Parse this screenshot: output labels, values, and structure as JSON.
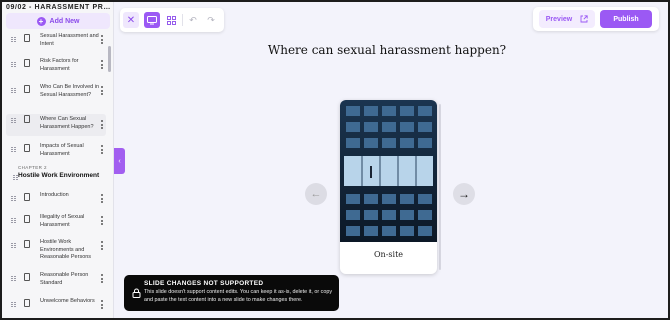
{
  "sidebar": {
    "course_title": "09/02 - HARASSMENT PRE...",
    "add_new_label": "Add New",
    "lessons_top": [
      {
        "label": "Sexual Harassment and Intent"
      },
      {
        "label": "Risk Factors for Harassment"
      },
      {
        "label": "Who Can Be Involved in Sexual Harassment?"
      },
      {
        "label": "Where Can Sexual Harassment Happen?",
        "active": true
      },
      {
        "label": "Impacts of Sexual Harassment"
      }
    ],
    "chapter": {
      "number_label": "CHAPTER 2",
      "title": "Hostile Work Environment"
    },
    "lessons_chapter": [
      {
        "label": "Introduction"
      },
      {
        "label": "Illegality of Sexual Harassment"
      },
      {
        "label": "Hostile Work Environments and Reasonable Persons"
      },
      {
        "label": "Reasonable Person Standard"
      },
      {
        "label": "Unwelcome Behaviors"
      }
    ],
    "collapse_icon": "chevron-left-icon"
  },
  "toolbar": {
    "close_icon": "close-icon",
    "desktop_icon": "desktop-icon",
    "grid_icon": "grid-icon",
    "undo_icon": "undo-icon",
    "redo_icon": "redo-icon"
  },
  "actions": {
    "preview_label": "Preview",
    "publish_label": "Publish"
  },
  "slide": {
    "title": "Where can sexual harassment happen?",
    "card_label": "On-site",
    "prev_icon": "arrow-left-icon",
    "next_icon": "arrow-right-icon"
  },
  "toast": {
    "title": "SLIDE CHANGES NOT SUPPORTED",
    "body": "This slide doesn't support content edits. You can keep it as-is, delete it, or copy and paste the text content into a new slide to make changes there."
  },
  "colors": {
    "accent": "#9b59f4",
    "accent_light": "#efe7fd",
    "canvas": "#f3f3fb",
    "toast_bg": "#0a0a0a"
  }
}
